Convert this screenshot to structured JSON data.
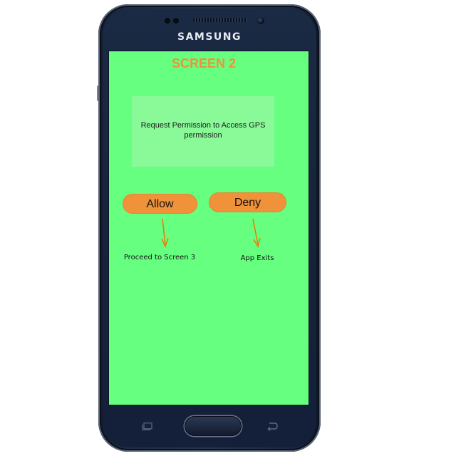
{
  "device": {
    "brand": "SAMSUNG"
  },
  "screen": {
    "title": "SCREEN 2",
    "background_color": "#66ff80",
    "dialog": {
      "message": "Request Permission to Access GPS permission",
      "background_color": "#8afa99"
    },
    "buttons": {
      "allow_label": "Allow",
      "deny_label": "Deny",
      "color": "#f0923a"
    },
    "annotations": {
      "allow_result": "Proceed to Screen 3",
      "deny_result": "App Exits",
      "arrow_color": "#f07800"
    }
  },
  "nav_icons": {
    "recent": "recent-apps-icon",
    "home": "home-button",
    "back": "back-icon"
  }
}
